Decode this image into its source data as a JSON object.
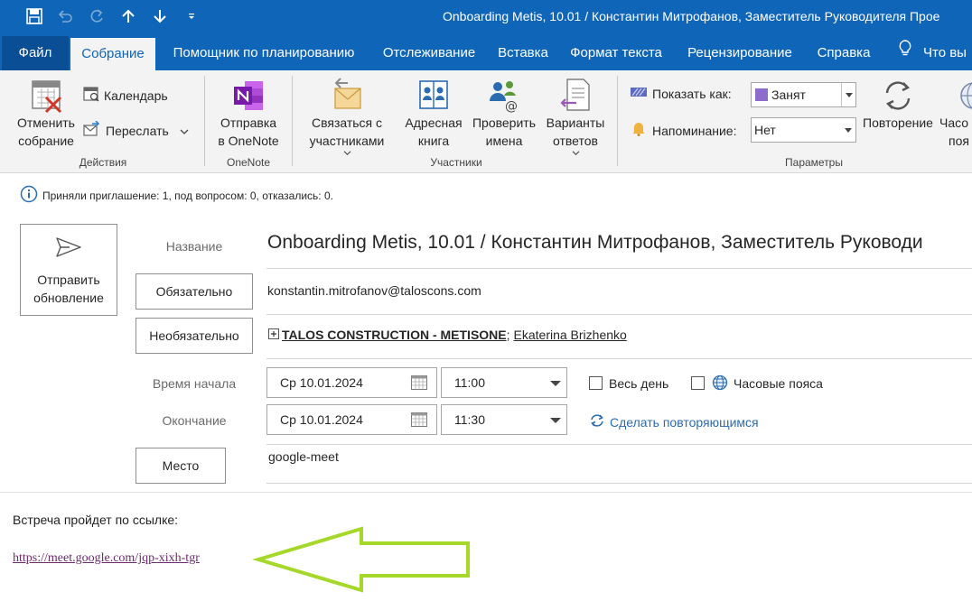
{
  "colors": {
    "accent": "#0f66b8",
    "arrow": "#a6d82a"
  },
  "window": {
    "title": "Onboarding Metis, 10.01 / Константин Митрофанов, Заместитель Руководителя Прое"
  },
  "quick_access": [
    "save-icon",
    "undo-icon",
    "redo-icon",
    "up-arrow-icon",
    "down-arrow-icon",
    "customize-icon"
  ],
  "tabs": [
    {
      "label": "Файл"
    },
    {
      "label": "Собрание"
    },
    {
      "label": "Помощник по планированию"
    },
    {
      "label": "Отслеживание"
    },
    {
      "label": "Вставка"
    },
    {
      "label": "Формат текста"
    },
    {
      "label": "Рецензирование"
    },
    {
      "label": "Справка"
    },
    {
      "label": "Что вы"
    }
  ],
  "ribbon": {
    "actions": {
      "cancel_line1": "Отменить",
      "cancel_line2": "собрание",
      "calendar": "Календарь",
      "forward": "Переслать",
      "group": "Действия"
    },
    "onenote": {
      "line1": "Отправка",
      "line2": "в OneNote",
      "group": "OneNote"
    },
    "attendees": {
      "contact_line1": "Связаться с",
      "contact_line2": "участниками",
      "book_line1": "Адресная",
      "book_line2": "книга",
      "check_line1": "Проверить",
      "check_line2": "имена",
      "resp_line1": "Варианты",
      "resp_line2": "ответов",
      "group": "Участники"
    },
    "options": {
      "show_as_label": "Показать как:",
      "show_as_value": "Занят",
      "reminder_label": "Напоминание:",
      "reminder_value": "Нет",
      "recurrence": "Повторение",
      "timezones_line1": "Часо",
      "timezones_line2": "поя",
      "group": "Параметры"
    }
  },
  "info": "Приняли приглашение: 1, под вопросом: 0, отказались: 0.",
  "form": {
    "send_update_line1": "Отправить",
    "send_update_line2": "обновление",
    "title_label": "Название",
    "title_value": "Onboarding Metis, 10.01 / Константин Митрофанов, Заместитель Руководи",
    "required_btn": "Обязательно",
    "required_value": "konstantin.mitrofanov@taloscons.com",
    "optional_btn": "Необязательно",
    "optional_group": "TALOS CONSTRUCTION - METISONE",
    "optional_sep": ";",
    "optional_person": "Ekaterina Brizhenko",
    "start_label": "Время начала",
    "start_date": "Ср 10.01.2024",
    "start_time": "11:00",
    "all_day": "Весь день",
    "time_zones": "Часовые пояса",
    "end_label": "Окончание",
    "end_date": "Ср 10.01.2024",
    "end_time": "11:30",
    "make_recurring": "Сделать повторяющимся",
    "location_btn": "Место",
    "location_value": "google-meet"
  },
  "body": {
    "text": "Встреча пройдет по ссылке:",
    "link": "https://meet.google.com/jqp-xixh-tgr"
  }
}
